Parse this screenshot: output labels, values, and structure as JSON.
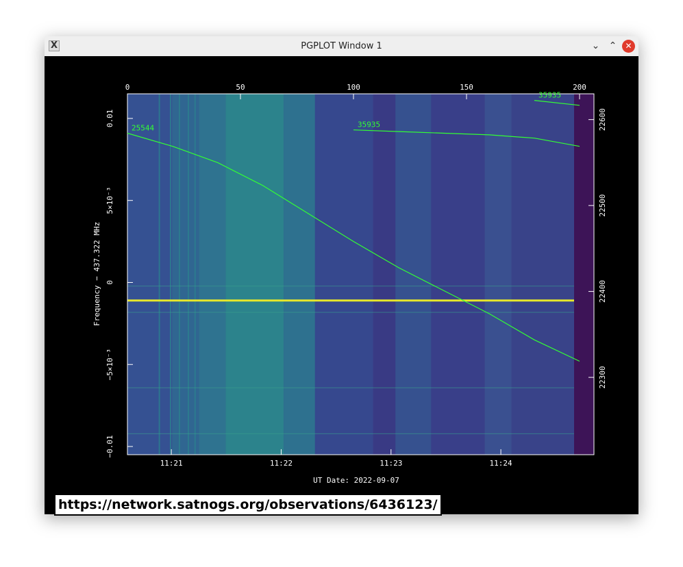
{
  "window": {
    "title": "PGPLOT Window 1",
    "app_icon": "x11-icon",
    "controls": {
      "minimize": "⌄",
      "maximize": "⌃",
      "close": "✕"
    }
  },
  "footer": {
    "url": "https://network.satnogs.org/observations/6436123/"
  },
  "chart_data": {
    "type": "heatmap",
    "title": "",
    "xlabel": "UT Date: 2022-09-07",
    "ylabel": "Frequency − 437.322 MHz",
    "x_ticks": [
      "11:21",
      "11:22",
      "11:23",
      "11:24"
    ],
    "x_time_range": [
      "11:20:36",
      "11:24:40"
    ],
    "top_axis": {
      "range": [
        0,
        200
      ],
      "ticks": [
        "0",
        "50",
        "100",
        "150",
        "200"
      ]
    },
    "y_range": [
      -0.0105,
      0.0115
    ],
    "y_ticks": [
      {
        "value": 0.01,
        "label": "0.01"
      },
      {
        "value": 0.005,
        "label": "5×10⁻³"
      },
      {
        "value": 0,
        "label": "0"
      },
      {
        "value": -0.005,
        "label": "−5×10⁻³"
      },
      {
        "value": -0.01,
        "label": "−0.01"
      }
    ],
    "right_axis": {
      "range": [
        22210,
        22630
      ],
      "ticks": [
        "22600",
        "22500",
        "22400",
        "22300"
      ]
    },
    "colormap": {
      "low": "#3a2d78",
      "mid": "#2a8f8c",
      "high": "#e8e82a"
    },
    "constant_signal_offset_mhz": -0.0011,
    "satellite_tracks": [
      {
        "label": "25544",
        "color": "#33ff33",
        "points": [
          [
            0,
            0.0091
          ],
          [
            20,
            0.0083
          ],
          [
            40,
            0.0073
          ],
          [
            60,
            0.0059
          ],
          [
            80,
            0.0042
          ],
          [
            100,
            0.0025
          ],
          [
            120,
            0.0009
          ],
          [
            140,
            -0.0005
          ],
          [
            160,
            -0.0019
          ],
          [
            180,
            -0.0035
          ],
          [
            200,
            -0.0048
          ]
        ]
      },
      {
        "label": "35935",
        "color": "#33ff33",
        "points": [
          [
            100,
            0.0093
          ],
          [
            120,
            0.0092
          ],
          [
            140,
            0.0091
          ],
          [
            160,
            0.009
          ],
          [
            180,
            0.0088
          ],
          [
            200,
            0.0083
          ]
        ]
      },
      {
        "label": "35935",
        "color": "#33ff33",
        "points": [
          [
            180,
            0.0111
          ],
          [
            200,
            0.0108
          ]
        ]
      }
    ]
  }
}
